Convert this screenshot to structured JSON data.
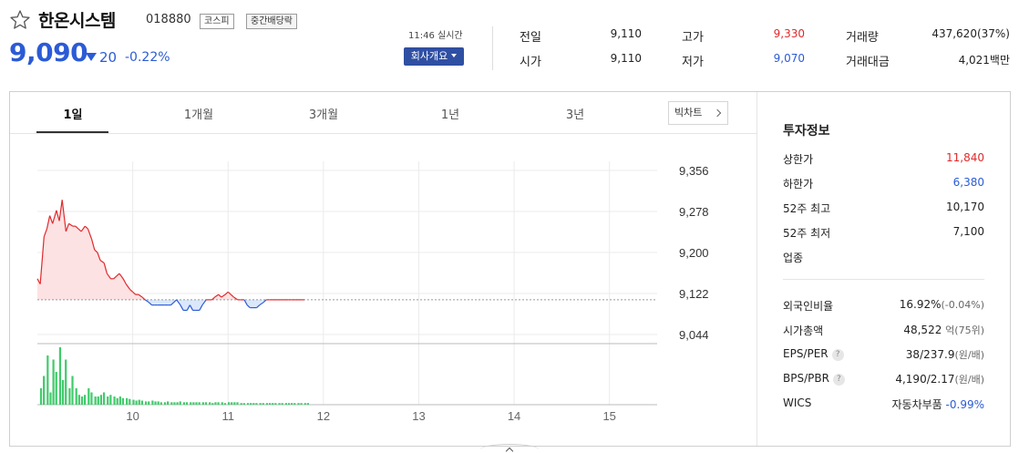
{
  "stock": {
    "name": "한온시스템",
    "code": "018880",
    "market_badge": "코스피",
    "dividend_badge": "중간배당락",
    "price": "9,090",
    "change": "20",
    "change_pct": "-0.22%",
    "realtime": "11:46 실시간",
    "company_button": "회사개요"
  },
  "quote": {
    "prev_label": "전일",
    "prev_value": "9,110",
    "open_label": "시가",
    "open_value": "9,110",
    "high_label": "고가",
    "high_value": "9,330",
    "low_label": "저가",
    "low_value": "9,070",
    "volume_label": "거래량",
    "volume_value": "437,620(37%)",
    "amount_label": "거래대금",
    "amount_value": "4,021백만"
  },
  "tabs": [
    "1일",
    "1개월",
    "3개월",
    "1년",
    "3년"
  ],
  "big_chart_button": "빅차트",
  "info": {
    "title": "투자정보",
    "upper_label": "상한가",
    "upper_value": "11,840",
    "lower_label": "하한가",
    "lower_value": "6,380",
    "high52_label": "52주 최고",
    "high52_value": "10,170",
    "low52_label": "52주 최저",
    "low52_value": "7,100",
    "industry_label": "업종",
    "foreign_label": "외국인비율",
    "foreign_value": "16.92%",
    "foreign_sub": "(-0.04%)",
    "mcap_label": "시가총액",
    "mcap_value": "48,522",
    "mcap_unit": "억",
    "mcap_sub": "(75위)",
    "eps_label": "EPS/PER",
    "eps_value": "38/237.9",
    "eps_unit": "(원/배)",
    "bps_label": "BPS/PBR",
    "bps_value": "4,190/2.17",
    "bps_unit": "(원/배)",
    "wics_label": "WICS",
    "wics_value": "자동차부품",
    "wics_pct": "-0.99%"
  },
  "colors": {
    "up": "#e0292c",
    "down": "#2b5bd6",
    "volume": "#3fcb6a",
    "brand": "#2f4fa3"
  },
  "chart_data": {
    "type": "line",
    "baseline": 9110,
    "ylim": [
      9044,
      9356
    ],
    "yticks": [
      "9,356",
      "9,278",
      "9,200",
      "9,122",
      "9,044"
    ],
    "xticks": [
      "10",
      "11",
      "12",
      "13",
      "14",
      "15"
    ],
    "x_range": [
      9.0,
      15.5
    ],
    "x": [
      9.0,
      9.03,
      9.07,
      9.1,
      9.13,
      9.16,
      9.2,
      9.23,
      9.26,
      9.3,
      9.33,
      9.37,
      9.4,
      9.43,
      9.46,
      9.5,
      9.53,
      9.57,
      9.6,
      9.63,
      9.66,
      9.7,
      9.73,
      9.77,
      9.8,
      9.83,
      9.86,
      9.9,
      9.93,
      9.97,
      10.0,
      10.03,
      10.06,
      10.1,
      10.13,
      10.17,
      10.2,
      10.23,
      10.26,
      10.3,
      10.33,
      10.37,
      10.4,
      10.43,
      10.46,
      10.5,
      10.53,
      10.57,
      10.6,
      10.63,
      10.66,
      10.7,
      10.73,
      10.77,
      10.8,
      10.83,
      10.86,
      10.9,
      10.93,
      10.97,
      11.0,
      11.03,
      11.06,
      11.1,
      11.13,
      11.17,
      11.2,
      11.23,
      11.26,
      11.3,
      11.33,
      11.37,
      11.4,
      11.43,
      11.46,
      11.5,
      11.53,
      11.57,
      11.6,
      11.63,
      11.66,
      11.7,
      11.73,
      11.77,
      11.8
    ],
    "price": [
      9150,
      9140,
      9230,
      9245,
      9270,
      9255,
      9280,
      9260,
      9300,
      9240,
      9255,
      9250,
      9250,
      9245,
      9240,
      9250,
      9245,
      9225,
      9205,
      9200,
      9185,
      9180,
      9160,
      9150,
      9150,
      9155,
      9160,
      9150,
      9140,
      9130,
      9125,
      9120,
      9120,
      9115,
      9110,
      9105,
      9100,
      9100,
      9100,
      9100,
      9100,
      9100,
      9100,
      9105,
      9110,
      9100,
      9090,
      9090,
      9100,
      9090,
      9090,
      9090,
      9100,
      9110,
      9110,
      9110,
      9115,
      9120,
      9115,
      9120,
      9125,
      9120,
      9115,
      9110,
      9110,
      9110,
      9100,
      9095,
      9095,
      9095,
      9100,
      9105,
      9110,
      9110,
      9110,
      9110,
      9110,
      9110,
      9110,
      9110,
      9110,
      9110,
      9110,
      9110,
      9110
    ],
    "volume": [
      20,
      35,
      60,
      15,
      55,
      40,
      70,
      30,
      55,
      20,
      35,
      20,
      12,
      10,
      12,
      20,
      15,
      10,
      10,
      12,
      15,
      10,
      12,
      10,
      8,
      10,
      8,
      8,
      7,
      6,
      5,
      6,
      5,
      4,
      4,
      5,
      4,
      4,
      3,
      3,
      4,
      3,
      3,
      3,
      4,
      3,
      3,
      3,
      3,
      3,
      3,
      3,
      3,
      3,
      2,
      3,
      3,
      3,
      2,
      3,
      3,
      3,
      3,
      2,
      2,
      2,
      2,
      2,
      2,
      2,
      2,
      2,
      2,
      2,
      2,
      2,
      2,
      2,
      2,
      2,
      2,
      2,
      2,
      2,
      2
    ]
  }
}
